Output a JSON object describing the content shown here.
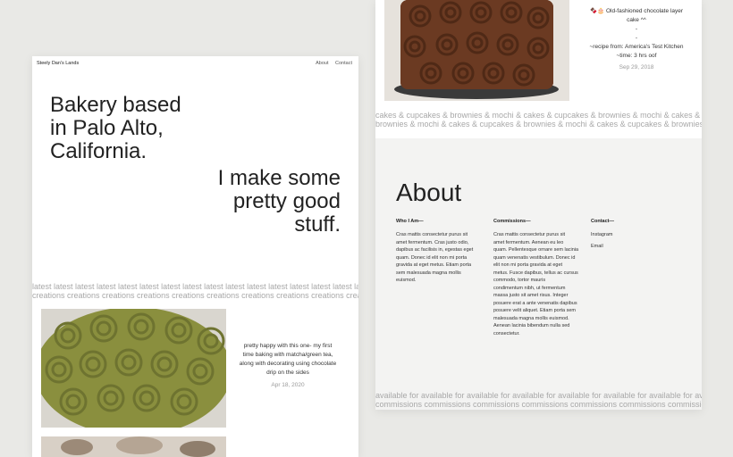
{
  "site": {
    "brand": "Steely Dan's Lands",
    "nav": [
      "About",
      "Contact"
    ]
  },
  "hero": {
    "line1": [
      "Bakery based",
      "in Palo Alto,",
      "California."
    ],
    "line2": [
      "I make some",
      "pretty good",
      "stuff."
    ]
  },
  "marquee_latest": {
    "row1": "latest latest latest latest latest latest latest latest latest latest latest latest latest latest latest latest",
    "row2": "creations creations creations creations creations creations creations creations creations creations"
  },
  "post1": {
    "caption": [
      "pretty happy with this one- my first",
      "time baking with matcha/green tea,",
      "along with decorating using chocolate",
      "drip on the sides"
    ],
    "date": "Apr 18, 2020"
  },
  "post2": {
    "caption": [
      "🍫🎂 Old-fashioned chocolate layer",
      "cake ^^",
      "-",
      "-",
      "~recipe from: America's Test Kitchen",
      "~time: 3 hrs oof"
    ],
    "date": "Sep 29, 2018"
  },
  "marquee_cakes": {
    "row1": "cakes & cupcakes & brownies & mochi & cakes & cupcakes & brownies & mochi & cakes & cupcakes",
    "row2": "brownies & mochi & cakes & cupcakes & brownies & mochi & cakes & cupcakes & brownies & mochi"
  },
  "about": {
    "title": "About",
    "who_heading": "Who I Am—",
    "who_text": [
      "Cras mattis consectetur purus sit",
      "amet fermentum. Cras justo odio,",
      "dapibus ac facilisis in, egestas eget",
      "quam. Donec id elit non mi porta",
      "gravida at eget metus. Etiam porta",
      "sem malesuada magna mollis",
      "euismod."
    ],
    "commissions_heading": "Commissions—",
    "commissions_text": [
      "Cras mattis consectetur purus sit",
      "amet fermentum. Aenean eu leo",
      "quam. Pellentesque ornare sem lacinia",
      "quam venenatis vestibulum. Donec id",
      "elit non mi porta gravida at eget",
      "metus. Fusce dapibus, tellus ac cursus",
      "commodo, tortor mauris",
      "condimentum nibh, ut fermentum",
      "massa justo sit amet risus. Integer",
      "posuere erat a ante venenatis dapibus",
      "posuere velit aliquet. Etiam porta sem",
      "malesuada magna mollis euismod.",
      "Aenean lacinia bibendum nulla sed",
      "consectetur."
    ],
    "contact_heading": "Contact—",
    "contact_links": [
      "Instagram",
      "Email"
    ]
  },
  "marquee_available": {
    "row1": "available for available for available for available for available for available for available for available for",
    "row2": "commissions commissions commissions commissions commissions commissions commissions commissions"
  }
}
